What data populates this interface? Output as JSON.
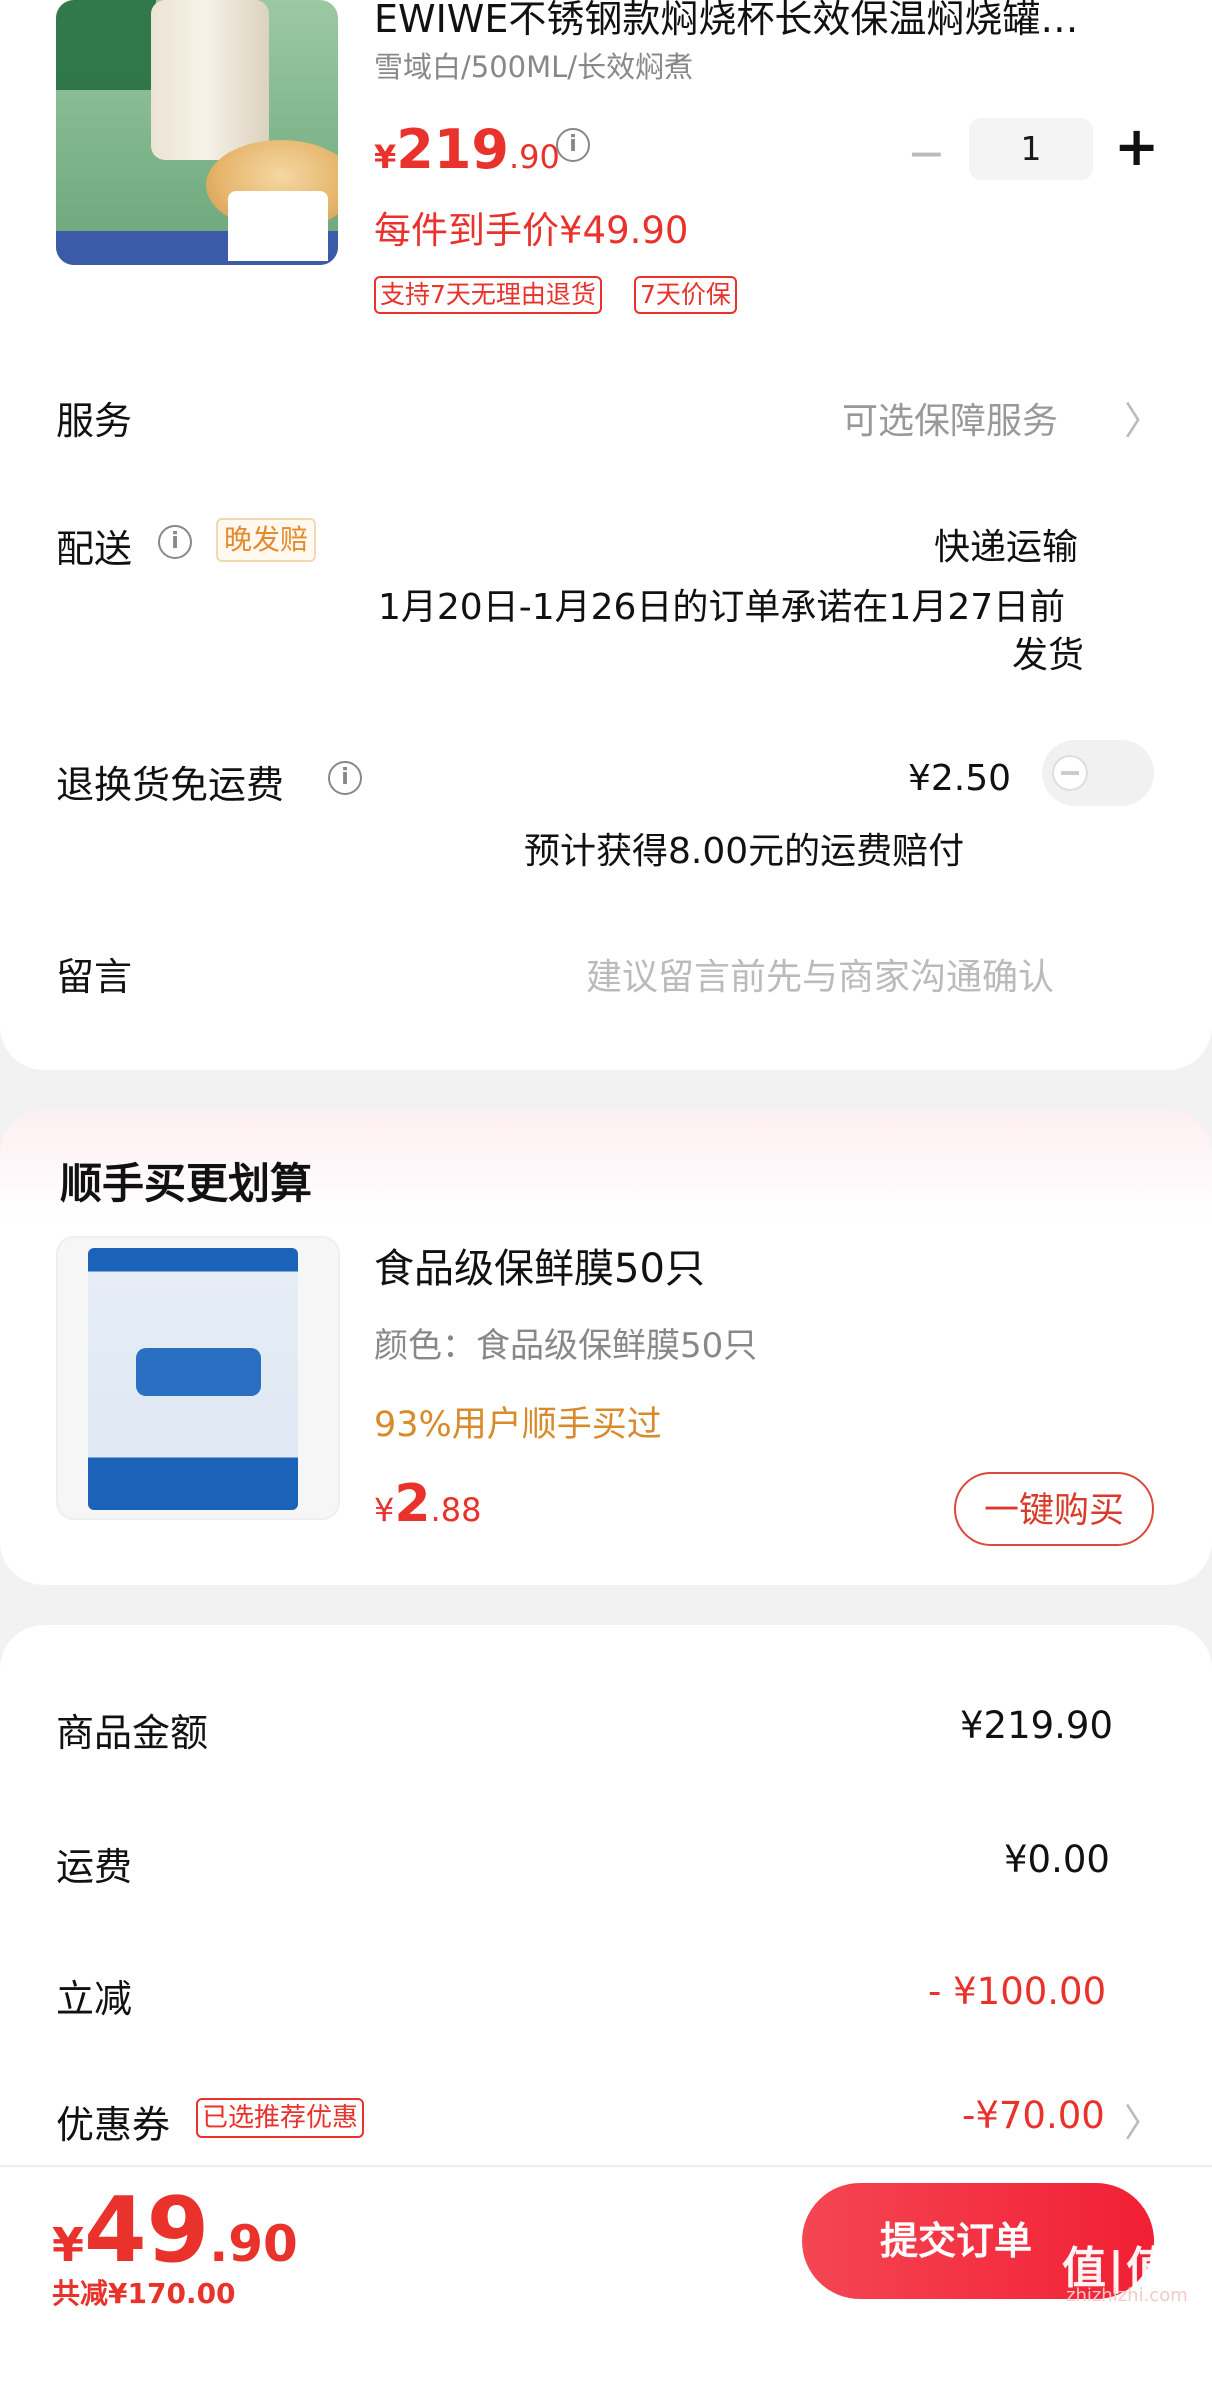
{
  "colors": {
    "accent_red": "#e8322b",
    "orange": "#d98a2a",
    "bg": "#f2f2f2"
  },
  "product": {
    "title": "EWIWE不锈钢款焖烧杯长效保温焖烧罐…",
    "spec": "雪域白/500ML/长效焖煮",
    "price_symbol": "¥",
    "price_int": "219",
    "price_dec": ".90",
    "hand_price": "每件到手价¥49.90",
    "quantity": "1",
    "minus": "−",
    "plus": "+",
    "tags": [
      "支持7天无理由退货",
      "7天价保"
    ],
    "info_icon": "i"
  },
  "rows": {
    "service_label": "服务",
    "service_value": "可选保障服务",
    "delivery_label": "配送",
    "delivery_tag": "晚发赔",
    "delivery_method": "快递运输",
    "delivery_promise_1": "1月20日-1月26日的订单承诺在1月27日前",
    "delivery_promise_2": "发货",
    "return_label": "退换货免运费",
    "return_price": "¥2.50",
    "return_note": "预计获得8.00元的运费赔付",
    "return_toggle_on": false,
    "message_label": "留言",
    "message_placeholder": "建议留言前先与商家沟通确认",
    "chevron": "〉"
  },
  "addon": {
    "section_title": "顺手买更划算",
    "name": "食品级保鲜膜50只",
    "spec": "颜色：食品级保鲜膜50只",
    "percent": "93%用户顺手买过",
    "price_symbol": "¥",
    "price_int": "2",
    "price_dec": ".88",
    "buy_label": "一键购买"
  },
  "summary": {
    "goods_label": "商品金额",
    "goods_value": "¥219.90",
    "shipping_label": "运费",
    "shipping_value": "¥0.00",
    "discount_label": "立减",
    "discount_value": "- ¥100.00",
    "coupon_label": "优惠券",
    "coupon_tag": "已选推荐优惠",
    "coupon_value": "-¥70.00"
  },
  "footer": {
    "yen": "¥",
    "total_int": "49",
    "total_dec": ".90",
    "reduced": "共减¥170.00",
    "submit_label": "提交订单",
    "watermark": "值|值|值",
    "watermark_url": "zhizhizhi.com"
  }
}
